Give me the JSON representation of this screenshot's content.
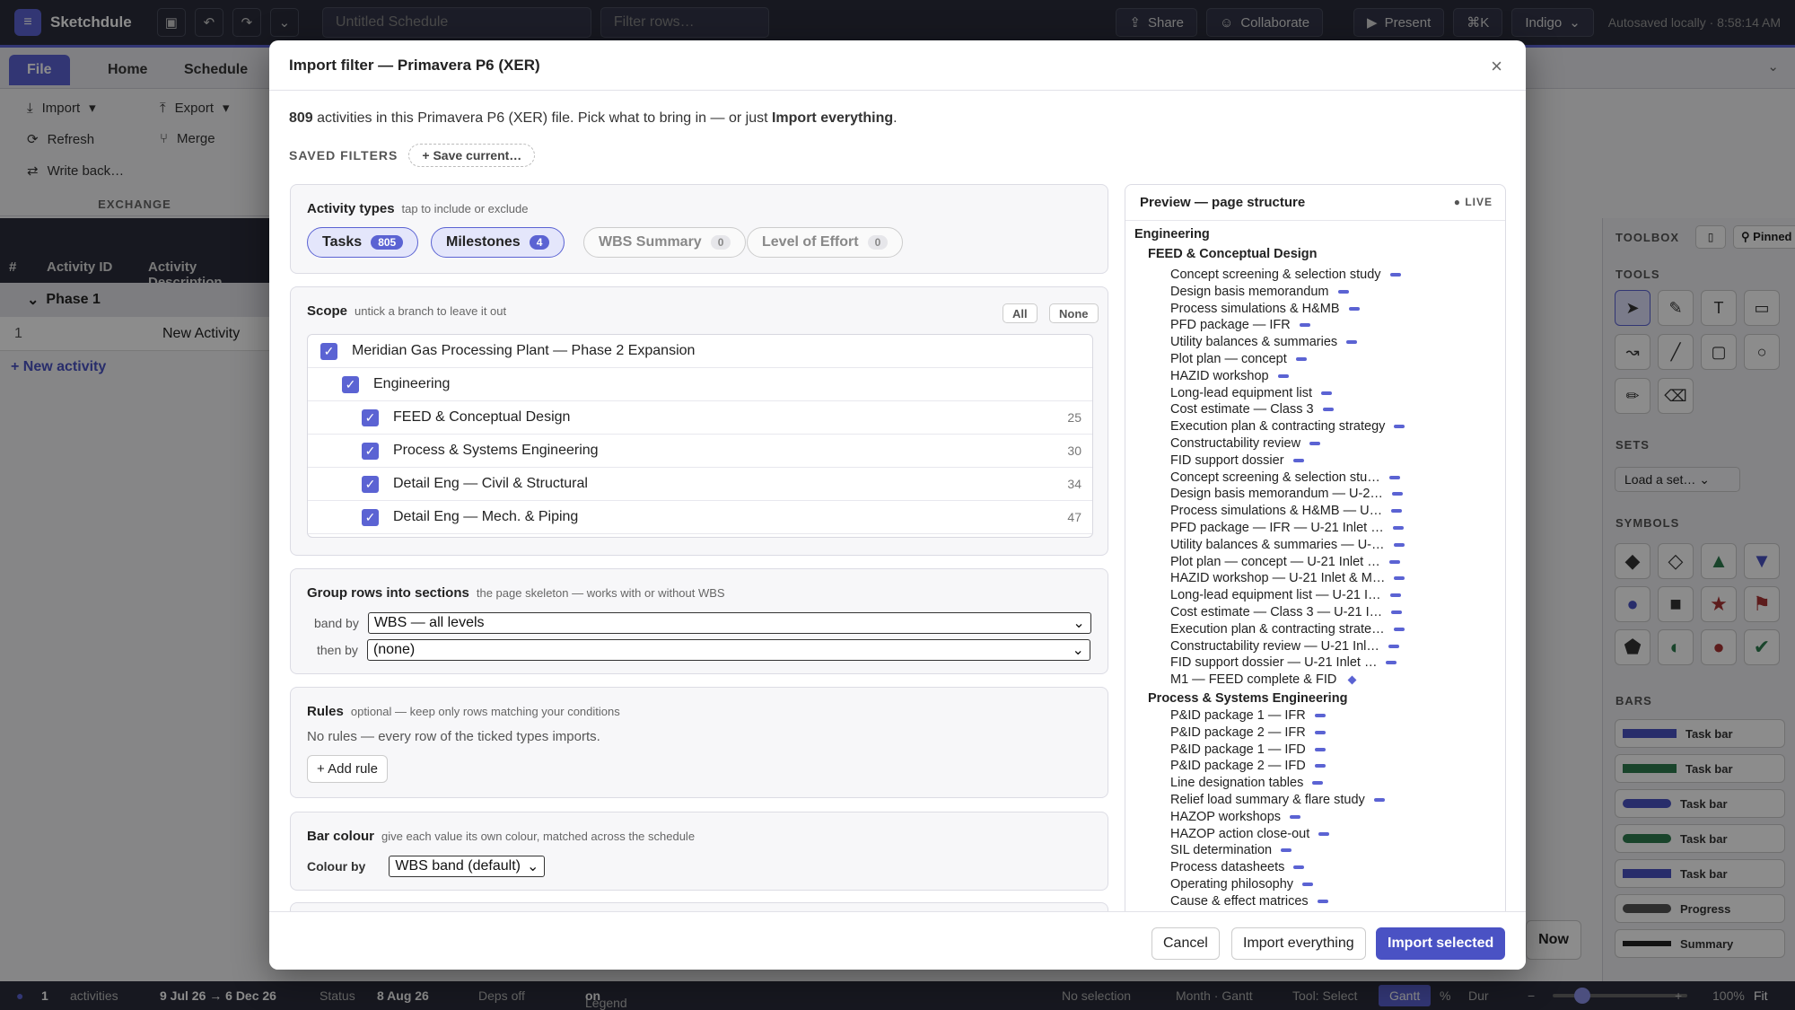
{
  "app": {
    "name": "Sketchdule",
    "title_placeholder": "Untitled Schedule",
    "filter_placeholder": "Filter rows…"
  },
  "topbar": {
    "share": "Share",
    "collaborate": "Collaborate",
    "present": "Present",
    "shortcut": "⌘K",
    "theme": "Indigo",
    "autosave": "Autosaved locally · 8:58:14 AM"
  },
  "ribbon": {
    "tabs": [
      "File",
      "Home",
      "Schedule"
    ],
    "items": {
      "import": "Import",
      "export": "Export",
      "refresh": "Refresh",
      "merge": "Merge",
      "writeback": "Write back…"
    },
    "group": "EXCHANGE"
  },
  "grid": {
    "headers": [
      "#",
      "Activity ID",
      "Activity Description"
    ],
    "phase": "Phase 1",
    "row_num": "1",
    "row_desc": "New Activity",
    "new_activity": "+ New activity"
  },
  "toolbox": {
    "title": "TOOLBOX",
    "pinned": "Pinned",
    "tools": "TOOLS",
    "sets": "SETS",
    "load_set": "Load a set…",
    "symbols": "SYMBOLS",
    "bars": "BARS",
    "bar_items": [
      "Task bar",
      "Task bar",
      "Task bar",
      "Task bar",
      "Task bar",
      "Progress",
      "Summary"
    ]
  },
  "status": {
    "count": "1",
    "activities": "activities",
    "range": "9 Jul 26 → 6 Dec 26",
    "status_lbl": "Status",
    "status_val": "8 Aug 26",
    "deps": "Deps off",
    "legend": "Legend",
    "legend_val": "on",
    "selection": "No selection",
    "view": "Month · Gantt",
    "tool": "Tool: Select",
    "gantt": "Gantt",
    "pct": "%",
    "dur": "Dur",
    "zoom": "100%",
    "fit": "Fit"
  },
  "modal": {
    "title": "Import filter — Primavera P6 (XER)",
    "close": "×",
    "intro_count": "809",
    "intro_text": " activities in this Primavera P6 (XER) file. Pick what to bring in — or just ",
    "intro_bold": "Import everything",
    "intro_end": ".",
    "saved_label": "SAVED FILTERS",
    "save_current": "+ Save current…",
    "activity_types": {
      "title": "Activity types",
      "sub": "tap to include or exclude",
      "chips": [
        {
          "label": "Tasks",
          "count": "805"
        },
        {
          "label": "Milestones",
          "count": "4"
        },
        {
          "label": "WBS Summary",
          "count": "0"
        },
        {
          "label": "Level of Effort",
          "count": "0"
        }
      ]
    },
    "scope": {
      "title": "Scope",
      "sub": "untick a branch to leave it out",
      "all": "All",
      "none": "None",
      "rows": [
        {
          "label": "Meridian Gas Processing Plant — Phase 2 Expansion",
          "count": ""
        },
        {
          "label": "Engineering",
          "count": ""
        },
        {
          "label": "FEED & Conceptual Design",
          "count": "25"
        },
        {
          "label": "Process & Systems Engineering",
          "count": "30"
        },
        {
          "label": "Detail Eng — Civil & Structural",
          "count": "34"
        },
        {
          "label": "Detail Eng — Mech. & Piping",
          "count": "47"
        }
      ]
    },
    "group": {
      "title": "Group rows into sections",
      "sub": "the page skeleton — works with or without WBS",
      "band_by": "band by",
      "band_val": "WBS — all levels",
      "then_by": "then by",
      "then_val": "(none)"
    },
    "rules": {
      "title": "Rules",
      "sub": "optional — keep only rows matching your conditions",
      "empty": "No rules — every row of the ticked types imports.",
      "add": "+ Add rule"
    },
    "colour": {
      "title": "Bar colour",
      "sub": "give each value its own colour, matched across the schedule",
      "by": "Colour by",
      "val": "WBS band (default)"
    },
    "preview": {
      "title": "Preview — page structure",
      "live": "● LIVE",
      "root": "Engineering",
      "group1": "FEED & Conceptual Design",
      "items1": [
        "Concept screening & selection study",
        "Design basis memorandum",
        "Process simulations & H&MB",
        "PFD package — IFR",
        "Utility balances & summaries",
        "Plot plan — concept",
        "HAZID workshop",
        "Long-lead equipment list",
        "Cost estimate — Class 3",
        "Execution plan & contracting strategy",
        "Constructability review",
        "FID support dossier",
        "Concept screening & selection stu…",
        "Design basis memorandum — U-2…",
        "Process simulations & H&MB — U…",
        "PFD package — IFR — U-21 Inlet …",
        "Utility balances & summaries — U-…",
        "Plot plan — concept — U-21 Inlet …",
        "HAZID workshop — U-21 Inlet & M…",
        "Long-lead equipment list — U-21 I…",
        "Cost estimate — Class 3 — U-21 I…",
        "Execution plan & contracting strate…",
        "Constructability review — U-21 Inl…",
        "FID support dossier — U-21 Inlet …"
      ],
      "milestone": "M1 — FEED complete & FID",
      "group2": "Process & Systems Engineering",
      "items2": [
        "P&ID package 1 — IFR",
        "P&ID package 2 — IFR",
        "P&ID package 1 — IFD",
        "P&ID package 2 — IFD",
        "Line designation tables",
        "Relief load summary & flare study",
        "HAZOP workshops",
        "HAZOP action close-out",
        "SIL determination",
        "Process datasheets",
        "Operating philosophy",
        "Cause & effect matrices"
      ]
    },
    "footer": {
      "cancel": "Cancel",
      "everything": "Import everything",
      "selected": "Import selected"
    }
  },
  "now_button": "Now"
}
